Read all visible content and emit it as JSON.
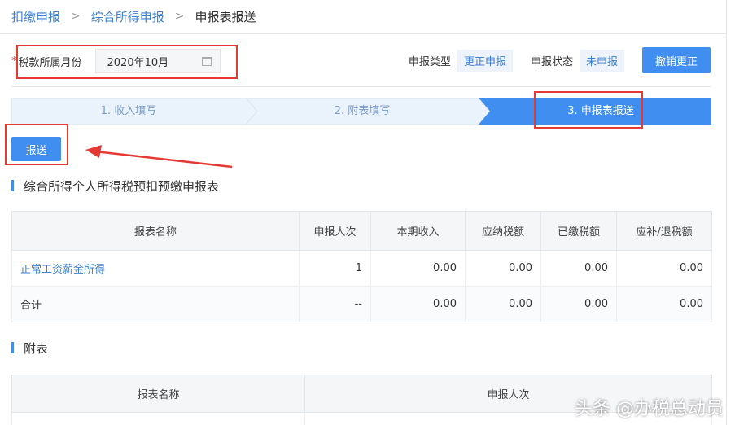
{
  "breadcrumb": {
    "items": [
      "扣缴申报",
      "综合所得申报",
      "申报表报送"
    ],
    "separator": ">"
  },
  "filter": {
    "required_mark": "*",
    "month_label": "税款所属月份",
    "month_value": "2020年10月"
  },
  "declaration": {
    "type_label": "申报类型",
    "type_value": "更正申报",
    "status_label": "申报状态",
    "status_value": "未申报",
    "revoke_button": "撤销更正"
  },
  "steps": [
    {
      "label": "1. 收入填写",
      "active": false
    },
    {
      "label": "2. 附表填写",
      "active": false
    },
    {
      "label": "3. 申报表报送",
      "active": true
    }
  ],
  "send_button": "报送",
  "main_table": {
    "title": "综合所得个人所得税预扣预缴申报表",
    "headers": [
      "报表名称",
      "申报人次",
      "本期收入",
      "应纳税额",
      "已缴税额",
      "应补/退税额"
    ],
    "rows": [
      [
        "正常工资薪金所得",
        "1",
        "0.00",
        "0.00",
        "0.00",
        "0.00"
      ],
      [
        "合计",
        "--",
        "0.00",
        "0.00",
        "0.00",
        "0.00"
      ]
    ]
  },
  "attach_table": {
    "title": "附表",
    "headers": [
      "报表名称",
      "申报人次"
    ]
  },
  "watermark": "头条 @办税总动员",
  "colors": {
    "primary": "#3f8ef0",
    "link": "#3d7fcf",
    "step_inactive_bg": "#eaf2fb",
    "highlight": "#e53935"
  }
}
